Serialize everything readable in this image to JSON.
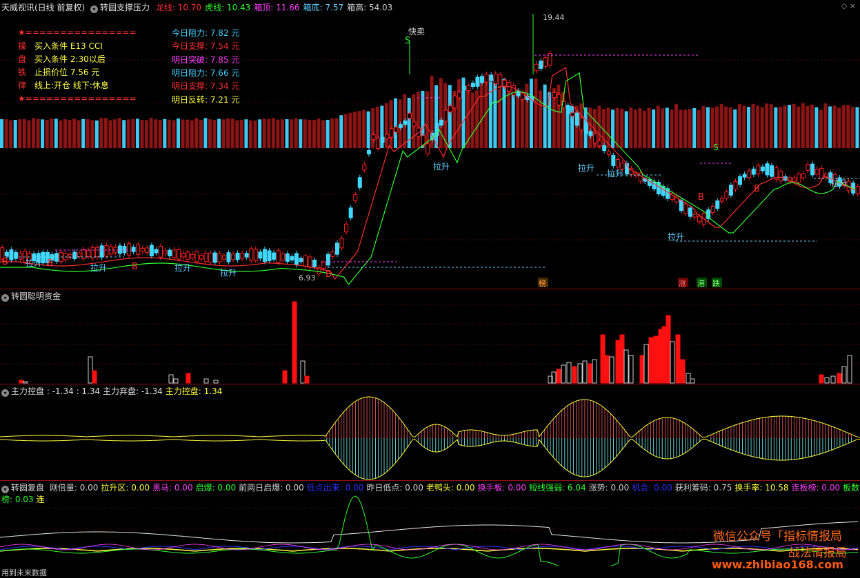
{
  "header": {
    "app_title": "天威视讯(日线 前复权)",
    "indicator_name": "转圆支撑压力",
    "items": [
      {
        "label": "龙线:",
        "value": "10.70",
        "color": "#ff3030"
      },
      {
        "label": "虎线:",
        "value": "10.43",
        "color": "#30ff30"
      },
      {
        "label": "箱顶:",
        "value": "11.66",
        "color": "#ff40ff"
      },
      {
        "label": "箱底:",
        "value": "7.57",
        "color": "#60d0ff"
      },
      {
        "label": "箱高:",
        "value": "54.03",
        "color": "#d0d0d0"
      }
    ]
  },
  "rules": {
    "star": "★",
    "sep": "================",
    "rows": [
      {
        "char": "操",
        "text": "买入条件 E13 CCI"
      },
      {
        "char": "盘",
        "text": "买入条件 2:30以后"
      },
      {
        "char": "铁",
        "text": "止损价位 7.56 元"
      },
      {
        "char": "律",
        "text": "线上:开仓 线下:休息"
      }
    ]
  },
  "levels": [
    {
      "label": "今日阻力:",
      "value": "7.82 元",
      "color": "#40d0ff"
    },
    {
      "label": "今日支撑:",
      "value": "7.54 元",
      "color": "#ff3030"
    },
    {
      "label": "明日突破:",
      "value": "7.85 元",
      "color": "#ff40ff"
    },
    {
      "label": "明日阻力:",
      "value": "7.66 元",
      "color": "#40d0ff"
    },
    {
      "label": "明日支撑:",
      "value": "7.34 元",
      "color": "#ff3030"
    },
    {
      "label": "明日反转:",
      "value": "7.21 元",
      "color": "#ffff40"
    }
  ],
  "price_labels": {
    "high": "19.44",
    "low": "6.93",
    "sell": "快卖",
    "sell_s": "S",
    "lift": "拉升",
    "buy_b": "B",
    "bang": "榜",
    "zhang": "涨",
    "gang": "港",
    "die": "跌"
  },
  "panel2": {
    "title": "转圆聪明资金"
  },
  "panel3": {
    "title": "主力控盘",
    "v1": ": -1.34",
    "v2": ": 1.34",
    "abandon_label": "主力弃盘:",
    "abandon_value": "-1.34",
    "control_label": "主力控盘:",
    "control_value": "1.34"
  },
  "panel4": {
    "title": "转圆复盘",
    "items": [
      {
        "label": "刚倍量:",
        "value": "0.00",
        "color": "#d0d0d0"
      },
      {
        "label": "拉升区:",
        "value": "0.00",
        "color": "#ffff40"
      },
      {
        "label": "黑马:",
        "value": "0.00",
        "color": "#ff40ff"
      },
      {
        "label": "启爆:",
        "value": "0.00",
        "color": "#30ff30"
      },
      {
        "label": "前两日启爆:",
        "value": "0.00",
        "color": "#d0d0d0"
      },
      {
        "label": "低点出来:",
        "value": "0.00",
        "color": "#3030ff"
      },
      {
        "label": "昨日低点:",
        "value": "0.00",
        "color": "#d0d0d0"
      },
      {
        "label": "老鸭头:",
        "value": "0.00",
        "color": "#ffff40"
      },
      {
        "label": "换手板:",
        "value": "0.00",
        "color": "#ff40ff"
      },
      {
        "label": "短线强弱:",
        "value": "6.04",
        "color": "#30ff30"
      },
      {
        "label": "涨势:",
        "value": "0.00",
        "color": "#d0d0d0"
      },
      {
        "label": "机会:",
        "value": "0.00",
        "color": "#3030ff"
      },
      {
        "label": "获利筹码:",
        "value": "0.75",
        "color": "#d0d0d0"
      },
      {
        "label": "换手率:",
        "value": "10.58",
        "color": "#ffff40"
      },
      {
        "label": "连板榜:",
        "value": "0.00",
        "color": "#ff40ff"
      },
      {
        "label": "板数榜:",
        "value": "0.03",
        "color": "#30ff30"
      },
      {
        "label": "连",
        "value": "",
        "color": "#ffff40"
      }
    ]
  },
  "watermark": {
    "line1": "微信公众号",
    "bracket": "「指标情报局",
    "line2": "战法情报局",
    "url": "www.zhibiao168.com"
  },
  "footer": "用到未来数据",
  "colors": {
    "up": "#ff2020",
    "down": "#40d8ff",
    "vol_red": "#8c1414",
    "vol_cyan": "#40c8f0"
  }
}
